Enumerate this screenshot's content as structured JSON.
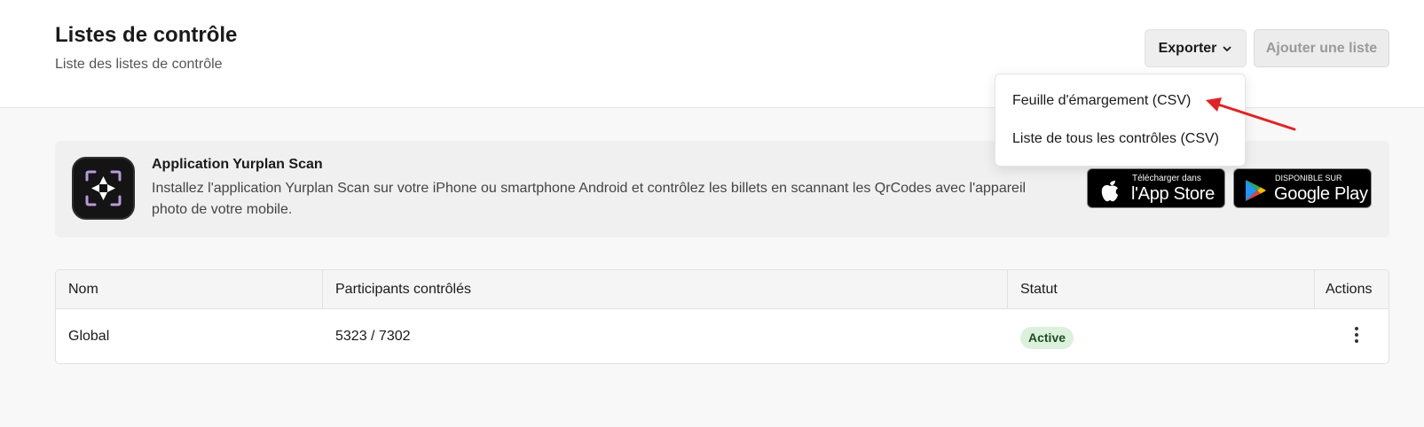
{
  "header": {
    "title": "Listes de contrôle",
    "subtitle": "Liste des listes de contrôle",
    "export_label": "Exporter",
    "add_label": "Ajouter une liste"
  },
  "export_menu": {
    "items": [
      "Feuille d'émargement (CSV)",
      "Liste de tous les contrôles (CSV)"
    ]
  },
  "banner": {
    "title": "Application Yurplan Scan",
    "description": "Installez l'application Yurplan Scan sur votre iPhone ou smartphone Android et contrôlez les billets en scannant les QrCodes avec l'appareil photo de votre mobile.",
    "app_store": {
      "small": "Télécharger dans",
      "big": "l'App Store"
    },
    "google_play": {
      "small": "DISPONIBLE SUR",
      "big": "Google Play"
    }
  },
  "table": {
    "columns": [
      "Nom",
      "Participants contrôlés",
      "Statut",
      "Actions"
    ],
    "rows": [
      {
        "name": "Global",
        "participants": "5323 / 7302",
        "status": "Active"
      }
    ]
  },
  "colors": {
    "status_bg": "#dcf1dc",
    "status_text": "#1f4d26",
    "annotation_arrow": "#e02424"
  }
}
